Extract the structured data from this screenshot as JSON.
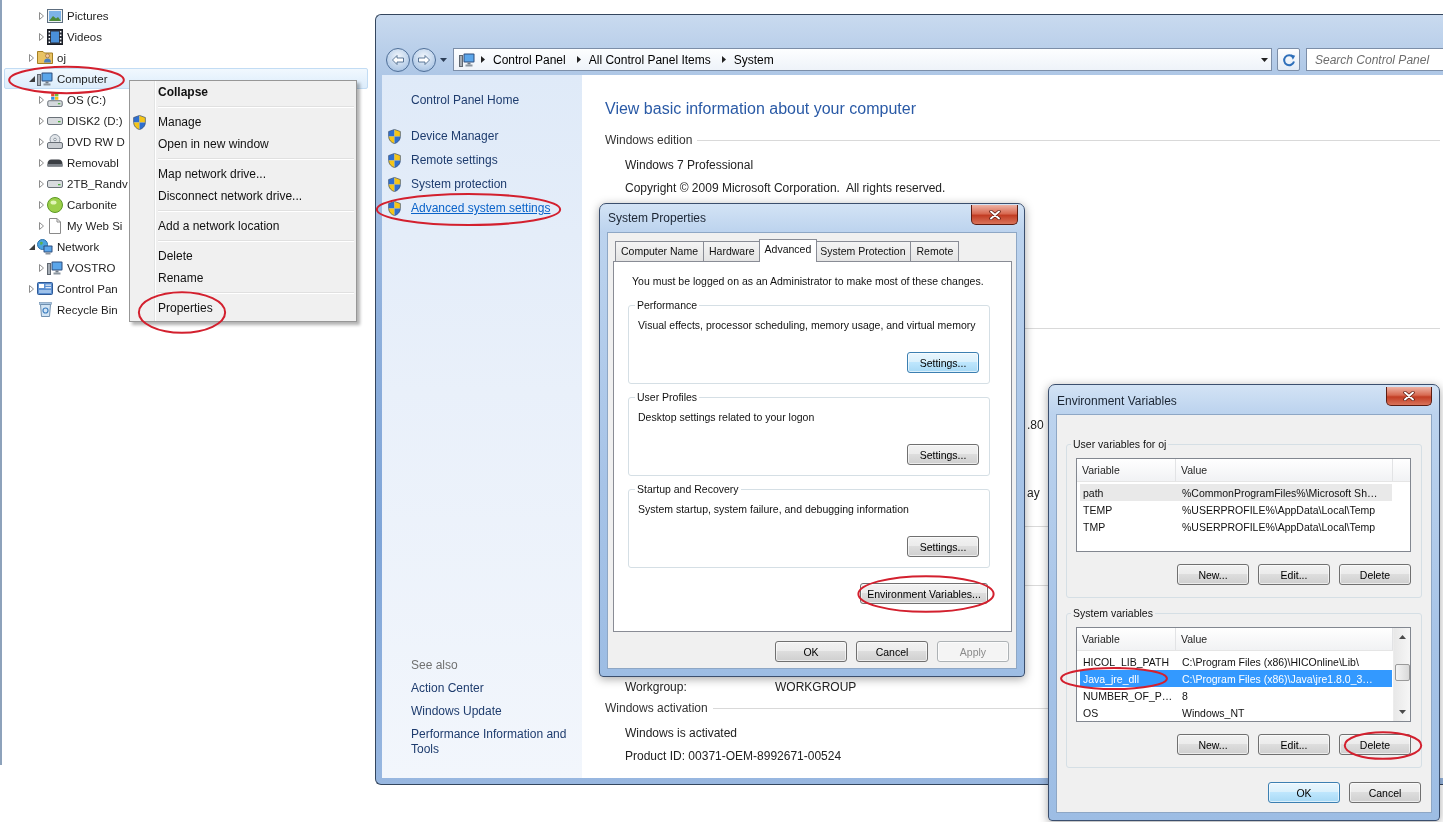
{
  "explorer_nav": {
    "tree": [
      {
        "children": [
          {
            "label": "Pictures",
            "kind": "pictures",
            "expandable": true,
            "expanded": false,
            "selected": false,
            "circled": false
          },
          {
            "label": "Videos",
            "kind": "videos",
            "expandable": true,
            "expanded": false,
            "selected": false,
            "circled": false
          }
        ]
      },
      {
        "label": "oj",
        "kind": "userfolder",
        "expandable": true,
        "expanded": false,
        "selected": false,
        "circled": false
      },
      {
        "label": "Computer",
        "kind": "computer",
        "expandable": true,
        "expanded": true,
        "selected": true,
        "circled": true,
        "children": [
          {
            "label": "OS (C:)",
            "kind": "osdrive",
            "expandable": true,
            "expanded": false,
            "selected": false,
            "circled": false
          },
          {
            "label": "DISK2 (D:)",
            "kind": "drive",
            "expandable": true,
            "expanded": false,
            "selected": false,
            "circled": false
          },
          {
            "label": "DVD RW D",
            "kind": "dvd",
            "expandable": true,
            "expanded": false,
            "selected": false,
            "circled": false
          },
          {
            "label": "Removabl",
            "kind": "removable",
            "expandable": true,
            "expanded": false,
            "selected": false,
            "circled": false
          },
          {
            "label": "2TB_Randv",
            "kind": "drive",
            "expandable": true,
            "expanded": false,
            "selected": false,
            "circled": false
          },
          {
            "label": "Carbonite",
            "kind": "carbonite",
            "expandable": true,
            "expanded": false,
            "selected": false,
            "circled": false
          },
          {
            "label": "My Web Si",
            "kind": "page",
            "expandable": true,
            "expanded": false,
            "selected": false,
            "circled": false
          }
        ]
      },
      {
        "label": "Network",
        "kind": "network",
        "expandable": true,
        "expanded": true,
        "selected": false,
        "circled": false,
        "children": [
          {
            "label": "VOSTRO",
            "kind": "computer",
            "expandable": true,
            "expanded": false,
            "selected": false,
            "circled": false
          }
        ]
      },
      {
        "label": "Control Pan",
        "kind": "controlpanel",
        "expandable": true,
        "expanded": false,
        "selected": false,
        "circled": false
      },
      {
        "label": "Recycle Bin",
        "kind": "recyclebin",
        "expandable": false,
        "selected": false,
        "circled": false
      }
    ]
  },
  "context_menu": {
    "groups": [
      [
        {
          "label": "Collapse",
          "kind": "plain",
          "default": true,
          "circled": false
        }
      ],
      [
        {
          "label": "Manage",
          "kind": "elevated",
          "default": false,
          "circled": false
        },
        {
          "label": "Open in new window",
          "kind": "plain",
          "default": false,
          "circled": false
        }
      ],
      [
        {
          "label": "Map network drive...",
          "kind": "plain",
          "default": false,
          "circled": false
        },
        {
          "label": "Disconnect network drive...",
          "kind": "plain",
          "default": false,
          "circled": false
        }
      ],
      [
        {
          "label": "Add a network location",
          "kind": "plain",
          "default": false,
          "circled": false
        }
      ],
      [
        {
          "label": "Delete",
          "kind": "plain",
          "default": false,
          "circled": false
        },
        {
          "label": "Rename",
          "kind": "plain",
          "default": false,
          "circled": false
        }
      ],
      [
        {
          "label": "Properties",
          "kind": "plain",
          "default": false,
          "circled": true
        }
      ]
    ]
  },
  "control_panel": {
    "breadcrumb": [
      "Control Panel",
      "All Control Panel Items",
      "System"
    ],
    "search": {
      "placeholder": "Search Control Panel"
    },
    "sidebar": {
      "home": "Control Panel Home",
      "tasks": [
        {
          "label": "Device Manager",
          "kind": "elevated",
          "hovered": false,
          "circled": false
        },
        {
          "label": "Remote settings",
          "kind": "elevated",
          "hovered": false,
          "circled": false
        },
        {
          "label": "System protection",
          "kind": "elevated",
          "hovered": false,
          "circled": false
        },
        {
          "label": "Advanced system settings",
          "kind": "elevated",
          "hovered": true,
          "circled": true
        }
      ],
      "see_also": {
        "title": "See also",
        "links": [
          "Action Center",
          "Windows Update",
          "Performance Information and Tools"
        ]
      }
    },
    "content": {
      "heading": "View basic information about your computer",
      "edition": {
        "title": "Windows edition",
        "lines": [
          "Windows 7 Professional",
          "Copyright © 2009 Microsoft Corporation.  All rights reserved."
        ]
      },
      "clipped_texts": [
        ".80",
        "ay"
      ],
      "workgroup": {
        "label": "Workgroup:",
        "value": "WORKGROUP"
      },
      "activation": {
        "title": "Windows activation",
        "lines": [
          "Windows is activated",
          "Product ID: 00371-OEM-8992671-00524"
        ]
      }
    }
  },
  "system_properties": {
    "title": "System Properties",
    "tabs": [
      {
        "label": "Computer Name",
        "selected": false
      },
      {
        "label": "Hardware",
        "selected": false
      },
      {
        "label": "Advanced",
        "selected": true
      },
      {
        "label": "System Protection",
        "selected": false
      },
      {
        "label": "Remote",
        "selected": false
      }
    ],
    "notice": "You must be logged on as an Administrator to make most of these changes.",
    "groups": [
      {
        "title": "Performance",
        "description": "Visual effects, processor scheduling, memory usage, and virtual memory",
        "button": {
          "label": "Settings...",
          "focused": true
        }
      },
      {
        "title": "User Profiles",
        "description": "Desktop settings related to your logon",
        "button": {
          "label": "Settings...",
          "focused": false
        }
      },
      {
        "title": "Startup and Recovery",
        "description": "System startup, system failure, and debugging information",
        "button": {
          "label": "Settings...",
          "focused": false
        }
      }
    ],
    "environment_button": {
      "label": "Environment Variables...",
      "circled": true
    },
    "buttons": [
      {
        "label": "OK",
        "disabled": false
      },
      {
        "label": "Cancel",
        "disabled": false
      },
      {
        "label": "Apply",
        "disabled": true
      }
    ]
  },
  "environment_variables": {
    "title": "Environment Variables",
    "user_variables": {
      "title": "User variables for oj",
      "columns": [
        "Variable",
        "Value"
      ],
      "rows": [
        {
          "variable": "path",
          "value": "%CommonProgramFiles%\\Microsoft Sh…",
          "selected": false,
          "hovered": true,
          "circled": false
        },
        {
          "variable": "TEMP",
          "value": "%USERPROFILE%\\AppData\\Local\\Temp",
          "selected": false,
          "hovered": false,
          "circled": false
        },
        {
          "variable": "TMP",
          "value": "%USERPROFILE%\\AppData\\Local\\Temp",
          "selected": false,
          "hovered": false,
          "circled": false
        }
      ],
      "buttons": [
        {
          "label": "New...",
          "circled": false
        },
        {
          "label": "Edit...",
          "circled": false
        },
        {
          "label": "Delete",
          "circled": false
        }
      ]
    },
    "system_variables": {
      "title": "System variables",
      "columns": [
        "Variable",
        "Value"
      ],
      "rows": [
        {
          "variable": "HICOL_LIB_PATH",
          "value": "C:\\Program Files (x86)\\HICOnline\\Lib\\",
          "selected": false,
          "hovered": false,
          "circled": false
        },
        {
          "variable": "Java_jre_dll",
          "value": "C:\\Program Files (x86)\\Java\\jre1.8.0_3…",
          "selected": true,
          "hovered": false,
          "circled": true
        },
        {
          "variable": "NUMBER_OF_P…",
          "value": "8",
          "selected": false,
          "hovered": false,
          "circled": false
        },
        {
          "variable": "OS",
          "value": "Windows_NT",
          "selected": false,
          "hovered": false,
          "circled": false
        }
      ],
      "buttons": [
        {
          "label": "New...",
          "circled": false
        },
        {
          "label": "Edit...",
          "circled": false
        },
        {
          "label": "Delete",
          "circled": true
        }
      ]
    },
    "buttons": [
      {
        "label": "OK",
        "default": true
      },
      {
        "label": "Cancel",
        "default": false
      }
    ]
  }
}
